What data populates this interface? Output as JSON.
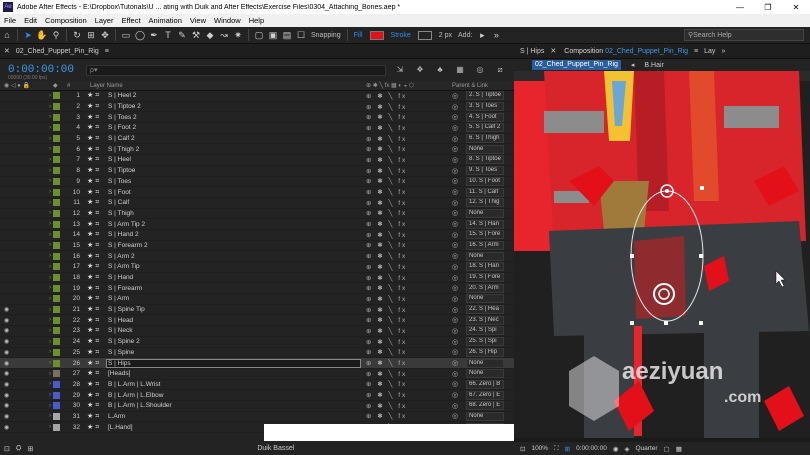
{
  "window": {
    "title": "Adobe After Effects - E:\\Dropbox\\Tutorials\\U ... ating with Duik and After Effects\\Exercise Files\\0304_Attaching_Bones.aep *",
    "minimize": "—",
    "maximize": "❐",
    "close": "✕",
    "app_icon": "Ae"
  },
  "menu": [
    "File",
    "Edit",
    "Composition",
    "Layer",
    "Effect",
    "Animation",
    "View",
    "Window",
    "Help"
  ],
  "toolbar": {
    "snapping_label": "Snapping",
    "fill_label": "Fill",
    "stroke_label": "Stroke",
    "stroke_px": "2 px",
    "add_label": "Add:",
    "search_placeholder": "Search Help",
    "fill_color": "#e3101a"
  },
  "timeline": {
    "tab_label": "02_Ched_Puppet_Pin_Rig",
    "timecode": "0:00:00:00",
    "subtime": "00000 (30.00 fps)",
    "search_placeholder": "ρ▾",
    "col_layer_name": "Layer Name",
    "col_parent": "Parent & Link",
    "layers": [
      {
        "num": "1",
        "name": "S | Heel 2",
        "parent": "2. S | Tiptoe"
      },
      {
        "num": "2",
        "name": "S | Tiptoe 2",
        "parent": "3. S | Toes"
      },
      {
        "num": "3",
        "name": "S | Toes 2",
        "parent": "4. S | Foot"
      },
      {
        "num": "4",
        "name": "S | Foot 2",
        "parent": "5. S | Calf 2"
      },
      {
        "num": "5",
        "name": "S | Calf 2",
        "parent": "6. S | Thigh"
      },
      {
        "num": "6",
        "name": "S | Thigh 2",
        "parent": "None"
      },
      {
        "num": "7",
        "name": "S | Heel",
        "parent": "8. S | Tiptoe"
      },
      {
        "num": "8",
        "name": "S | Tiptoe",
        "parent": "9. S | Toes"
      },
      {
        "num": "9",
        "name": "S | Toes",
        "parent": "10. S | Foot"
      },
      {
        "num": "10",
        "name": "S | Foot",
        "parent": "11. S | Calf"
      },
      {
        "num": "11",
        "name": "S | Calf",
        "parent": "12. S | Thig"
      },
      {
        "num": "12",
        "name": "S | Thigh",
        "parent": "None"
      },
      {
        "num": "13",
        "name": "S | Arm Tip 2",
        "parent": "14. S | Han"
      },
      {
        "num": "14",
        "name": "S | Hand 2",
        "parent": "15. S | Fore"
      },
      {
        "num": "15",
        "name": "S | Forearm 2",
        "parent": "16. S | Arm"
      },
      {
        "num": "16",
        "name": "S | Arm 2",
        "parent": "None"
      },
      {
        "num": "17",
        "name": "S | Arm Tip",
        "parent": "18. S | Han"
      },
      {
        "num": "18",
        "name": "S | Hand",
        "parent": "19. S | Fore"
      },
      {
        "num": "19",
        "name": "S | Forearm",
        "parent": "20. S | Arm"
      },
      {
        "num": "20",
        "name": "S | Arm",
        "parent": "None"
      },
      {
        "num": "21",
        "name": "S | Spine Tip",
        "parent": "22. S | Hea"
      },
      {
        "num": "22",
        "name": "S | Head",
        "parent": "23. S | Nec"
      },
      {
        "num": "23",
        "name": "S | Neck",
        "parent": "24. S | Spi"
      },
      {
        "num": "24",
        "name": "S | Spine 2",
        "parent": "25. S | Spi"
      },
      {
        "num": "25",
        "name": "S | Spine",
        "parent": "26. S | Hip"
      },
      {
        "num": "26",
        "name": "S | Hips",
        "parent": "None"
      },
      {
        "num": "27",
        "name": "[Heads]",
        "parent": "None"
      },
      {
        "num": "28",
        "name": "B | L.Arm | L.Wrist",
        "parent": "66. Zero | B"
      },
      {
        "num": "29",
        "name": "B | L.Arm | L.Elbow",
        "parent": "67. Zero | E"
      },
      {
        "num": "30",
        "name": "B | L.Arm | L.Shoulder",
        "parent": "68. Zero | E"
      },
      {
        "num": "31",
        "name": "L.Arm",
        "parent": "None"
      },
      {
        "num": "32",
        "name": "[L.Hand]",
        "parent": "None"
      }
    ],
    "status_text": "Duik Bassel"
  },
  "viewer": {
    "panel_tab": "S | Hips",
    "comp_prefix": "Composition",
    "comp_name": "02_Ched_Puppet_Pin_Rig",
    "lay_tab": "Lay",
    "sub_tab_active": "02_Ched_Puppet_Pin_Rig",
    "sub_tab_2": "B.Hair",
    "zoom": "100%",
    "timecode": "0:00:00:00",
    "quality": "Quarter",
    "watermark": "aeziyuan",
    "watermark_sub": ".com"
  }
}
